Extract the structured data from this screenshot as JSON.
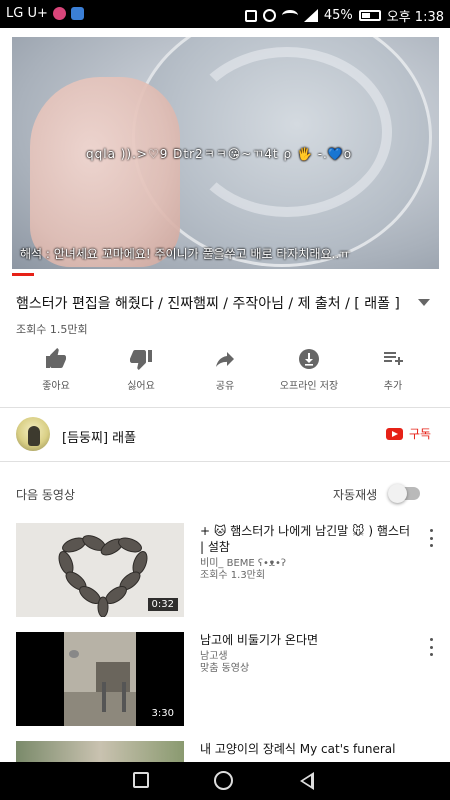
{
  "status_bar": {
    "carrier": "LG U+",
    "battery": "45%",
    "time": "오후 1:38"
  },
  "video": {
    "overlay_caption_top": "qqla )).>♡9 Dtr2ㅋㅋ😘~ㄲ4t ρ 🖐️ -.💙o",
    "overlay_caption_bottom": "해석 : 안녀세요 꼬마에요! 주이니가 풀을쑤고 배로 타자치래요..ㅠ",
    "progress": 0.05
  },
  "title": "햄스터가 편집을 해줬다 / 진짜햄찌 / 주작아님 / 제 출처 / [ 래폴 ]",
  "views": "조회수 1.5만회",
  "actions": [
    {
      "label": "좋아요",
      "icon": "thumb-up-icon"
    },
    {
      "label": "싫어요",
      "icon": "thumb-down-icon"
    },
    {
      "label": "공유",
      "icon": "share-icon"
    },
    {
      "label": "오프라인 저장",
      "icon": "download-icon"
    },
    {
      "label": "추가",
      "icon": "add-to-playlist-icon"
    }
  ],
  "channel": {
    "name": "[듬둥찌] 래폴",
    "subscribe_label": "구독"
  },
  "up_next": {
    "label": "다음 동영상",
    "autoplay_label": "자동재생",
    "autoplay_on": false
  },
  "videos": [
    {
      "title": "+ 🐱 햄스터가 나에게 남긴말 🐭 ) 햄스터 | 설참",
      "channel": "비미_ BEME ʕ•ᴥ•ʔ",
      "views": "조회수 1.3만회",
      "duration": "0:32"
    },
    {
      "title": "남고에 비둘기가 온다면",
      "channel": "남고생",
      "views": "맞춤 동영상",
      "duration": "3:30"
    },
    {
      "title": "내 고양이의 장례식  My cat's funeral",
      "channel": "",
      "views": "",
      "duration": ""
    }
  ],
  "colors": {
    "accent_red": "#e62117",
    "status_bar_bg": "#000000"
  }
}
